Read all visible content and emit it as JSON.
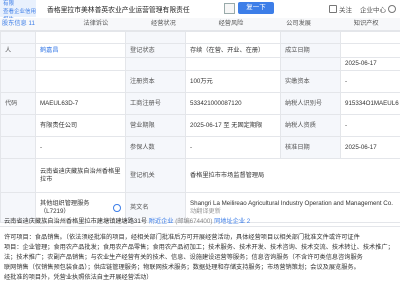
{
  "topbar": {
    "tag_line1": "有限",
    "tag_line2": "查看企业信用报告",
    "title": "香格里拉市美林普英农业产业运营管理有限责任",
    "copy_label": "复一下",
    "action_fav": "关注",
    "action_more": "企业中心"
  },
  "tabs": [
    "股东信息 11",
    "法律诉讼",
    "经营状况",
    "经营风险",
    "公司发展",
    "知识产权"
  ],
  "rows": {
    "r1": {
      "c1": "",
      "c2": "",
      "c3": "",
      "c4": "",
      "c5": "",
      "c6": ""
    },
    "r2": {
      "c1": "人",
      "c2": "鹤嘉昌",
      "c3": "登记状态",
      "c4": "存续（在营、开业、在册）",
      "c5": "成立日期",
      "c6": ""
    },
    "r3": {
      "c1": "",
      "c2": "",
      "c3": "",
      "c4": "",
      "c5": "",
      "c6": "2025-06-17"
    },
    "r4": {
      "c1": "",
      "c2": "",
      "c3": "注册资本",
      "c4": "100万元",
      "c5": "实缴资本",
      "c6": "-"
    },
    "r5": {
      "c1": "代码",
      "c2": "MAEUL63D-7",
      "c3": "工商注册号",
      "c4": "533421000087120",
      "c5": "纳税人识别号",
      "c6": "915334O1MAEUL6"
    },
    "r6": {
      "c1": "",
      "c2": "有限责任公司",
      "c3": "营业期限",
      "c4": "2025-06-17 至 无固定期限",
      "c5": "纳税人资质",
      "c6": "-"
    },
    "r7": {
      "c1": "",
      "c2": "-",
      "c3": "参保人数",
      "c4": "-",
      "c5": "核准日期",
      "c6": "2025-06-17"
    },
    "r8": {
      "c1": "",
      "c2": "云南省迪庆藏族自治州香格里拉市",
      "c3": "登记机关",
      "c4": "香格里拉市市场监督管理局",
      "c5": "",
      "c6": ""
    },
    "r9": {
      "c1": "",
      "c2": "其他组织管理服务（L7219）",
      "c3": "英文名",
      "c4": "Shangri La Meilireao Agricultural Industry Operation and Management Co.",
      "c5": "",
      "c6": ""
    },
    "r9b": {
      "c4": "动翻译更新"
    }
  },
  "address": {
    "text": "云南省迪庆藏族自治州香格里拉市建塘镇建塘路31号",
    "near": "附近企业",
    "extra": "(邮编674400)",
    "more": "同地址企业 2"
  },
  "scope": {
    "line1": "许可项目：食品销售。（依法须经批准的项目，经相关部门批准后方可开展经营活动，具体经营项目以相关部门批准文件或许可证件",
    "line2": "项目：企业管理；食用农产品批发；食用农产品零售；食用农产品初加工；技术服务、技术开发、技术咨询、技术交流、技术转让、技术推广；",
    "line3": "法；技术推广；农副产品销售；与农业生产经营有关的技术、信息、设施建设运营等服务；信息咨询服务（不含许可类信息咨询服务",
    "line4": "联网销售（仅销售预包装食品）；供应链管理服务；物联网技术服务；数据处理和存储支持服务；市场营销策划；会议及展览服务。",
    "line5": "经批准的项目外，凭营业执照依法自主开展经营活动）"
  }
}
